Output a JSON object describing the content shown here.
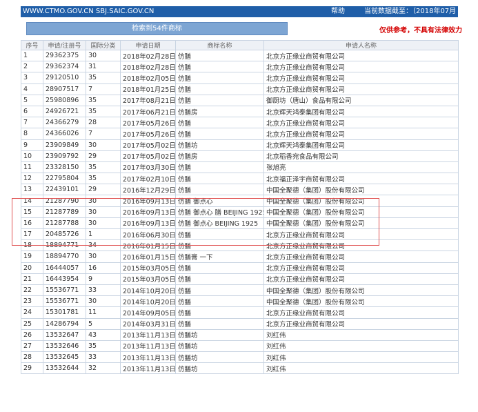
{
  "header": {
    "url": "WWW.CTMO.GOV.CN SBJ.SAIC.GOV.CN",
    "help": "帮助",
    "data_cutoff": "当前数据截至：（2018年07月03日）"
  },
  "result_bar": "检索到54件商标",
  "disclaimer": "仅供参考，不具有法律效力",
  "columns": [
    "序号",
    "申请/注册号",
    "国际分类",
    "申请日期",
    "商标名称",
    "申请人名称"
  ],
  "rows": [
    {
      "no": "1",
      "reg": "29362375",
      "cls": "30",
      "date": "2018年02月28日",
      "mark": "仿膳",
      "applicant": "北京方正缘业商贸有限公司"
    },
    {
      "no": "2",
      "reg": "29362374",
      "cls": "31",
      "date": "2018年02月28日",
      "mark": "仿膳",
      "applicant": "北京方正缘业商贸有限公司"
    },
    {
      "no": "3",
      "reg": "29120510",
      "cls": "35",
      "date": "2018年02月05日",
      "mark": "仿膳",
      "applicant": "北京方正缘业商贸有限公司"
    },
    {
      "no": "4",
      "reg": "28907517",
      "cls": "7",
      "date": "2018年01月25日",
      "mark": "仿膳",
      "applicant": "北京方正缘业商贸有限公司"
    },
    {
      "no": "5",
      "reg": "25980896",
      "cls": "35",
      "date": "2017年08月21日",
      "mark": "仿膳",
      "applicant": "御厨坊（唐山）食品有限公司"
    },
    {
      "no": "6",
      "reg": "24926721",
      "cls": "35",
      "date": "2017年06月21日",
      "mark": "仿膳房",
      "applicant": "北京辉天鸿泰集团有限公司"
    },
    {
      "no": "7",
      "reg": "24366279",
      "cls": "28",
      "date": "2017年05月26日",
      "mark": "仿膳",
      "applicant": "北京方正缘业商贸有限公司"
    },
    {
      "no": "8",
      "reg": "24366026",
      "cls": "7",
      "date": "2017年05月26日",
      "mark": "仿膳",
      "applicant": "北京方正缘业商贸有限公司"
    },
    {
      "no": "9",
      "reg": "23909849",
      "cls": "30",
      "date": "2017年05月02日",
      "mark": "仿膳坊",
      "applicant": "北京辉天鸿泰集团有限公司"
    },
    {
      "no": "10",
      "reg": "23909792",
      "cls": "29",
      "date": "2017年05月02日",
      "mark": "仿膳房",
      "applicant": "北京稻香宛食品有限公司"
    },
    {
      "no": "11",
      "reg": "23328150",
      "cls": "35",
      "date": "2017年03月30日",
      "mark": "仿膳",
      "applicant": "张旭亮"
    },
    {
      "no": "12",
      "reg": "22795804",
      "cls": "35",
      "date": "2017年02月10日",
      "mark": "仿膳",
      "applicant": "北京福正泽宇商贸有限公司"
    },
    {
      "no": "13",
      "reg": "22439101",
      "cls": "29",
      "date": "2016年12月29日",
      "mark": "仿膳",
      "applicant": "中国全聚德（集团）股份有限公司"
    },
    {
      "no": "14",
      "reg": "21287790",
      "cls": "30",
      "date": "2016年09月13日",
      "mark": "仿膳 御点心",
      "applicant": "中国全聚德（集团）股份有限公司"
    },
    {
      "no": "15",
      "reg": "21287789",
      "cls": "30",
      "date": "2016年09月13日",
      "mark": "仿膳 御点心 膳 BEIJING 1925",
      "applicant": "中国全聚德（集团）股份有限公司"
    },
    {
      "no": "16",
      "reg": "21287788",
      "cls": "30",
      "date": "2016年09月13日",
      "mark": "仿膳 御点心 BEIJING 1925",
      "applicant": "中国全聚德（集团）股份有限公司"
    },
    {
      "no": "17",
      "reg": "20485726",
      "cls": "1",
      "date": "2016年06月30日",
      "mark": "仿膳",
      "applicant": "北京方正缘业商贸有限公司"
    },
    {
      "no": "18",
      "reg": "18894771",
      "cls": "34",
      "date": "2016年01月15日",
      "mark": "仿膳",
      "applicant": "北京方正缘业商贸有限公司"
    },
    {
      "no": "19",
      "reg": "18894770",
      "cls": "30",
      "date": "2016年01月15日",
      "mark": "仿膳膏 一下",
      "applicant": "北京方正缘业商贸有限公司"
    },
    {
      "no": "20",
      "reg": "16444057",
      "cls": "16",
      "date": "2015年03月05日",
      "mark": "仿膳",
      "applicant": "北京方正缘业商贸有限公司"
    },
    {
      "no": "21",
      "reg": "16443954",
      "cls": "9",
      "date": "2015年03月05日",
      "mark": "仿膳",
      "applicant": "北京方正缘业商贸有限公司"
    },
    {
      "no": "22",
      "reg": "15536771",
      "cls": "33",
      "date": "2014年10月20日",
      "mark": "仿膳",
      "applicant": "中国全聚德（集团）股份有限公司"
    },
    {
      "no": "23",
      "reg": "15536771",
      "cls": "30",
      "date": "2014年10月20日",
      "mark": "仿膳",
      "applicant": "中国全聚德（集团）股份有限公司"
    },
    {
      "no": "24",
      "reg": "15301781",
      "cls": "11",
      "date": "2014年09月05日",
      "mark": "仿膳",
      "applicant": "北京方正缘业商贸有限公司"
    },
    {
      "no": "25",
      "reg": "14286794",
      "cls": "5",
      "date": "2014年03月31日",
      "mark": "仿膳",
      "applicant": "北京方正缘业商贸有限公司"
    },
    {
      "no": "26",
      "reg": "13532647",
      "cls": "43",
      "date": "2013年11月13日",
      "mark": "仿膳坊",
      "applicant": "刘红伟"
    },
    {
      "no": "27",
      "reg": "13532646",
      "cls": "35",
      "date": "2013年11月13日",
      "mark": "仿膳坊",
      "applicant": "刘红伟"
    },
    {
      "no": "28",
      "reg": "13532645",
      "cls": "33",
      "date": "2013年11月13日",
      "mark": "仿膳坊",
      "applicant": "刘红伟"
    },
    {
      "no": "29",
      "reg": "13532644",
      "cls": "32",
      "date": "2013年11月13日",
      "mark": "仿膳坊",
      "applicant": "刘红伟"
    }
  ]
}
